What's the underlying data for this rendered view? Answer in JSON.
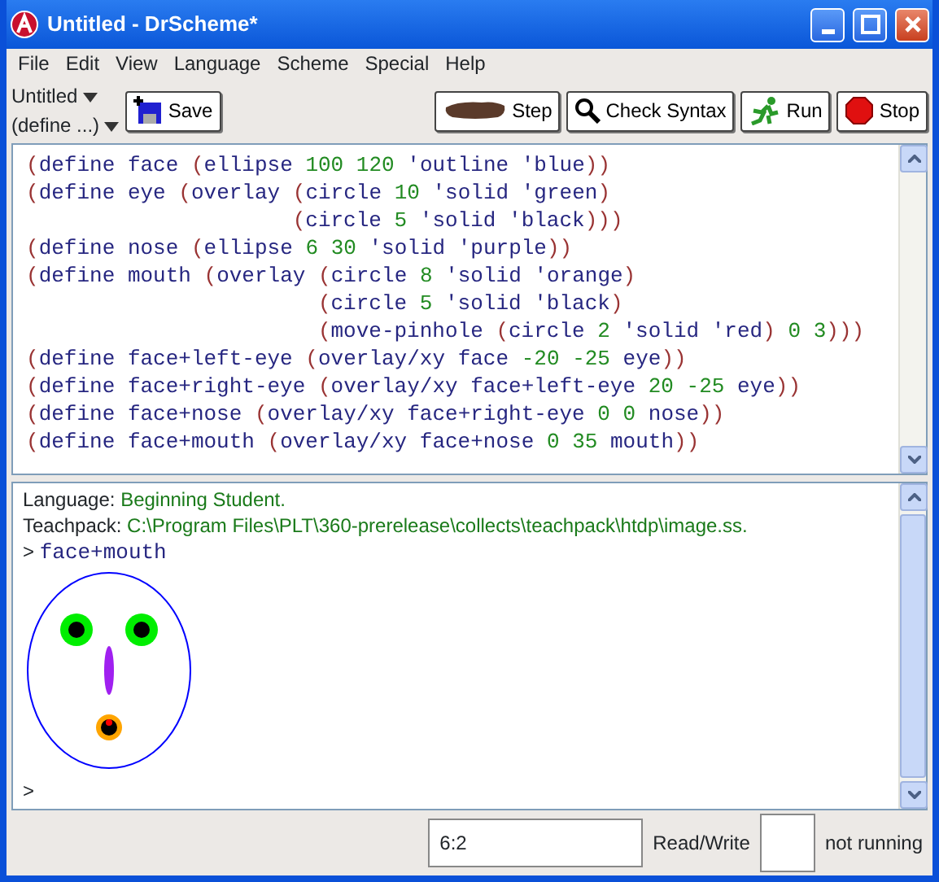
{
  "window": {
    "title": "Untitled - DrScheme*"
  },
  "menu": [
    "File",
    "Edit",
    "View",
    "Language",
    "Scheme",
    "Special",
    "Help"
  ],
  "toolbar": {
    "file_menu": "Untitled",
    "define_menu": "(define ...)",
    "save": "Save",
    "buttons": [
      {
        "kind": "step",
        "label": "Step"
      },
      {
        "kind": "check",
        "label": "Check Syntax"
      },
      {
        "kind": "run",
        "label": "Run"
      },
      {
        "kind": "stop",
        "label": "Stop"
      }
    ]
  },
  "editor": {
    "lines": [
      "(define face (ellipse 100 120 'outline 'blue))",
      "(define eye (overlay (circle 10 'solid 'green)",
      "                     (circle 5 'solid 'black)))",
      "(define nose (ellipse 6 30 'solid 'purple))",
      "(define mouth (overlay (circle 8 'solid 'orange)",
      "                       (circle 5 'solid 'black)",
      "                       (move-pinhole (circle 2 'solid 'red) 0 3)))",
      "(define face+left-eye (overlay/xy face -20 -25 eye))",
      "(define face+right-eye (overlay/xy face+left-eye 20 -25 eye))",
      "(define face+nose (overlay/xy face+right-eye 0 0 nose))",
      "(define face+mouth (overlay/xy face+nose 0 35 mouth))"
    ]
  },
  "interactions": {
    "info": [
      {
        "label": "Language:",
        "value": "Beginning Student."
      },
      {
        "label": "Teachpack:",
        "value": "C:\\Program Files\\PLT\\360-prerelease\\collects\\teachpack\\htdp\\image.ss."
      }
    ],
    "prompt": ">",
    "input": "face+mouth",
    "next_prompt": ">"
  },
  "status_bar": {
    "position": "6:2",
    "mode": "Read/Write",
    "state": "not running"
  }
}
